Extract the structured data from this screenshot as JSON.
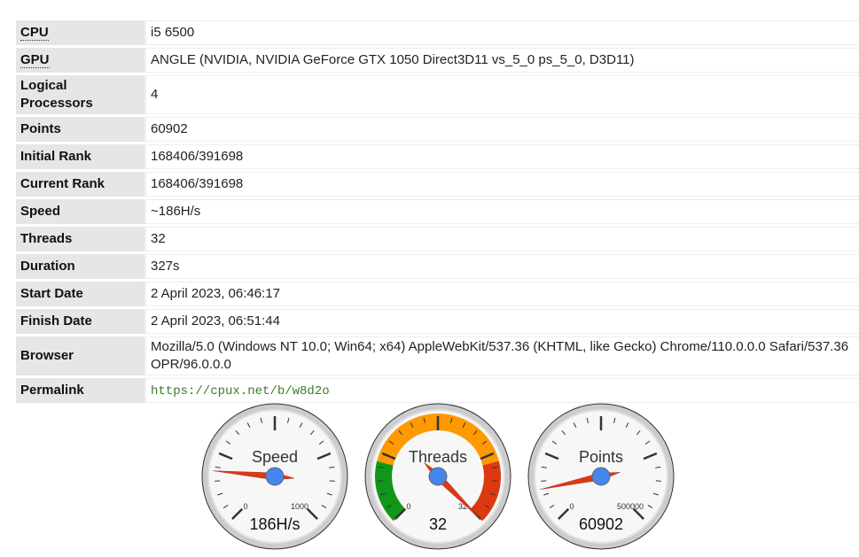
{
  "rows": [
    {
      "label": "CPU",
      "value": "i5 6500",
      "abbr": true
    },
    {
      "label": "GPU",
      "value": "ANGLE (NVIDIA, NVIDIA GeForce GTX 1050 Direct3D11 vs_5_0 ps_5_0, D3D11)",
      "abbr": true
    },
    {
      "label": "Logical Processors",
      "value": "4"
    },
    {
      "label": "Points",
      "value": "60902"
    },
    {
      "label": "Initial Rank",
      "value": "168406/391698"
    },
    {
      "label": "Current Rank",
      "value": "168406/391698"
    },
    {
      "label": "Speed",
      "value": "~186H/s"
    },
    {
      "label": "Threads",
      "value": "32"
    },
    {
      "label": "Duration",
      "value": "327s"
    },
    {
      "label": "Start Date",
      "value": "2 April 2023, 06:46:17"
    },
    {
      "label": "Finish Date",
      "value": "2 April 2023, 06:51:44"
    },
    {
      "label": "Browser",
      "value": "Mozilla/5.0 (Windows NT 10.0; Win64; x64) AppleWebKit/537.36 (KHTML, like Gecko) Chrome/110.0.0.0 Safari/537.36 OPR/96.0.0.0"
    },
    {
      "label": "Permalink",
      "value": "https://cpux.net/b/w8d2o",
      "link": true
    }
  ],
  "gauges": [
    {
      "title": "Speed",
      "value": 186,
      "display": "186H/s",
      "min": 0,
      "max": 1000,
      "min_label": "0",
      "max_label": "1000",
      "bands": []
    },
    {
      "title": "Threads",
      "value": 32,
      "display": "32",
      "min": 0,
      "max": 32,
      "min_label": "0",
      "max_label": "32",
      "bands": [
        {
          "from": 0,
          "to": 7,
          "color": "#109618"
        },
        {
          "from": 7,
          "to": 25,
          "color": "#ff9900"
        },
        {
          "from": 25,
          "to": 32,
          "color": "#dc3912"
        }
      ]
    },
    {
      "title": "Points",
      "value": 60902,
      "display": "60902",
      "min": 0,
      "max": 500000,
      "min_label": "0",
      "max_label": "500000",
      "bands": []
    }
  ],
  "colors": {
    "needle": "#dc3912",
    "hub": "#4684ee"
  }
}
